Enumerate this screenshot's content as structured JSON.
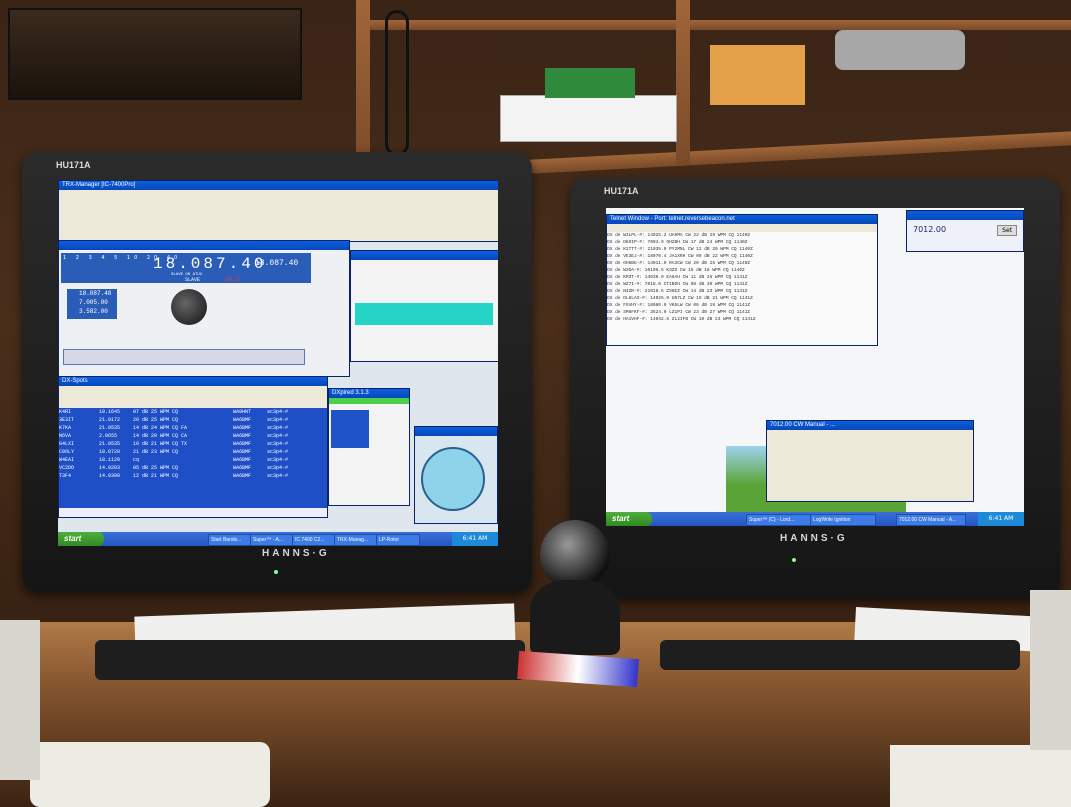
{
  "left_monitor": {
    "model_label": "HU171A",
    "brand": "HANNS·G",
    "main_title": "TRX-Manager [IC-7400Pro]",
    "freq_display": "18.087.40",
    "freq_secondary": "18.087.40",
    "freq_stack": [
      "18.087.40",
      "7.005.00",
      "3.582.00"
    ],
    "mode_labels": {
      "slave": "SLAVE",
      "slave_on": "SLAVE ON ATU2",
      "split": "SPLIT"
    },
    "band_buttons": [
      "1",
      "2",
      "3",
      "4",
      "5",
      "10",
      "20",
      "40"
    ],
    "mini_window_title": "DXpired 3.1.3",
    "spotlist_title": "DX-Spots",
    "spot_rows": [
      {
        "call": "K4RI",
        "freq": "18.1645",
        "info": "07 dB 25 WPM CQ",
        "spotter": "WA9HNT",
        "src": "sc3p4-#"
      },
      {
        "call": "3E3IT",
        "freq": "21.0172",
        "info": "20 dB 25 WPM CQ",
        "spotter": "WA6BMF",
        "src": "sc3p4-#"
      },
      {
        "call": "K7KA",
        "freq": "21.0535",
        "info": "14 dB 24 WPM CQ FA",
        "spotter": "WA6BMF",
        "src": "sc3p4-#"
      },
      {
        "call": "N6VA",
        "freq": "2.0655",
        "info": "14 dB 20 WPM CQ CA",
        "spotter": "WA6BMF",
        "src": "sc3p4-#"
      },
      {
        "call": "G4LXI",
        "freq": "21.0535",
        "info": "10 dB 21 WPM CQ TX",
        "spotter": "WA6BMF",
        "src": "sc3p4-#"
      },
      {
        "call": "C06LY",
        "freq": "18.0720",
        "info": "21 dB 23 WPM CQ",
        "spotter": "WA6BMF",
        "src": "sc3p4-#"
      },
      {
        "call": "W4EAI",
        "freq": "18.1120",
        "info": "cq",
        "spotter": "WA6BMF",
        "src": "sc3p4-#"
      },
      {
        "call": "VC2DO",
        "freq": "14.0203",
        "info": "05 dB 25 WPM CQ",
        "spotter": "WA6BMF",
        "src": "sc3p4-#"
      },
      {
        "call": "T3F4",
        "freq": "14.0300",
        "info": "12 dB 21 WPM CQ",
        "spotter": "WA6BMF",
        "src": "sc3p4-#"
      }
    ],
    "taskbar": {
      "start": "start",
      "buttons": [
        "Start Bands...",
        "Super™ - A...",
        "IC 7400 C2...",
        "TRX-Manag...",
        "LP-Rotor"
      ],
      "clock": "6:41 AM"
    }
  },
  "right_monitor": {
    "model_label": "HU171A",
    "brand": "HANNS·G",
    "telnet_title": "Telnet Window - Port: telnet.reversebeacon.net",
    "telnet_rows": [
      "DX de W3LPL-#:   14025.2  UA9MA  CW 22 dB 29 WPM CQ  1140Z",
      "DX de DK9IP-#:    7004.9  OH2BH  CW 17 dB 24 WPM CQ  1140Z",
      "DX de K1TTT-#:   21035.0  PY2MNL CW 12 dB 20 WPM CQ  1140Z",
      "DX de VE3EJ-#:   18070.4  JA1XRH CW 09 dB 22 WPM CQ  1140Z",
      "DX de OH6BG-#:   14011.0  RA3CW  CW 20 dB 25 WPM CQ  1140Z",
      "DX de W3OA-#:    10106.5  K3ZO   CW 15 dB 18 WPM CQ  1140Z",
      "DX de KM3T-#:    14030.0  EA8AH  CW 11 dB 26 WPM CQ  1141Z",
      "DX de WZ7I-#:     7018.0  CT1BOH CW 08 dB 30 WPM CQ  1141Z",
      "DX de N4ZR-#:    21018.5  ZS6EZ  CW 14 dB 23 WPM CQ  1141Z",
      "DX de DL8LAS-#:  14025.9  UN7LZ  CW 19 dB 21 WPM CQ  1141Z",
      "DX de F5VHY-#:   18080.0  VK6LW  CW 06 dB 19 WPM CQ  1141Z",
      "DX de SM6FKF-#:   3524.0  LZ1PJ  CW 23 dB 27 WPM CQ  1141Z",
      "DX de HA1VHF-#:  14042.5  ZL2IFB CW 10 dB 24 WPM CQ  1141Z"
    ],
    "side_clock": "7012.00",
    "side_button": "Set",
    "dialog_title": "7012.00 CW Manual - ...",
    "taskbar": {
      "start": "start",
      "buttons": [
        "Super™ (C) - Lord...",
        "LogWrite Ignition",
        "7012.00 CW Manual - A..."
      ],
      "clock": "6:41 AM"
    }
  }
}
